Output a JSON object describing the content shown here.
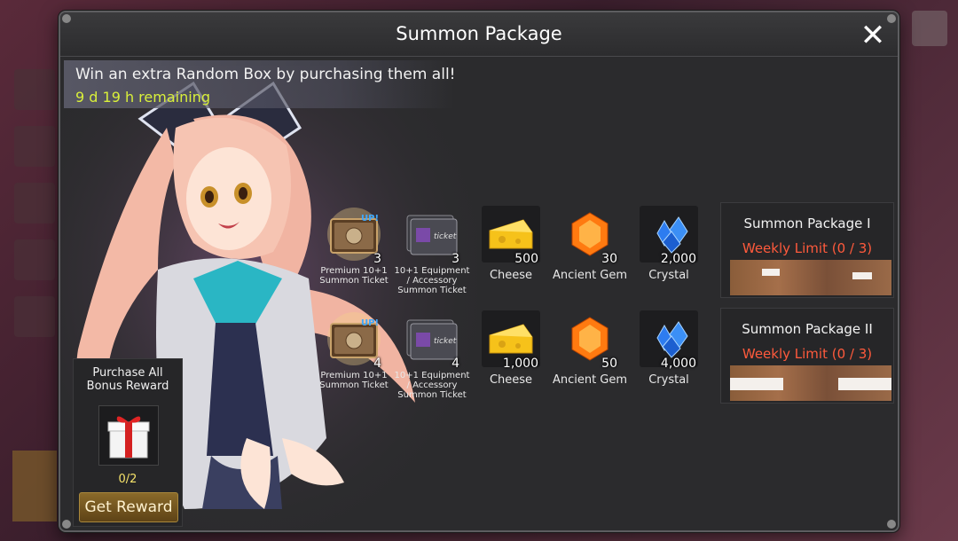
{
  "window": {
    "title": "Summon Package",
    "close_glyph": "✕"
  },
  "promo": {
    "text": "Win an extra Random Box by purchasing them all!",
    "timer": "9 d 19 h remaining"
  },
  "rows": [
    {
      "items": [
        {
          "icon": "premium-summon-ticket-icon",
          "qty": "3",
          "label": "Premium 10+1 Summon Ticket"
        },
        {
          "icon": "equipment-summon-ticket-icon",
          "qty": "3",
          "label": "10+1 Equipment / Accessory Summon Ticket"
        },
        {
          "icon": "cheese-icon",
          "qty": "500",
          "label": "Cheese"
        },
        {
          "icon": "ancient-gem-icon",
          "qty": "30",
          "label": "Ancient Gem"
        },
        {
          "icon": "crystal-icon",
          "qty": "2,000",
          "label": "Crystal"
        }
      ]
    },
    {
      "items": [
        {
          "icon": "premium-summon-ticket-icon",
          "qty": "4",
          "label": "Premium 10+1 Summon Ticket"
        },
        {
          "icon": "equipment-summon-ticket-icon",
          "qty": "4",
          "label": "10+1 Equipment / Accessory Summon Ticket"
        },
        {
          "icon": "cheese-icon",
          "qty": "1,000",
          "label": "Cheese"
        },
        {
          "icon": "ancient-gem-icon",
          "qty": "50",
          "label": "Ancient Gem"
        },
        {
          "icon": "crystal-icon",
          "qty": "4,000",
          "label": "Crystal"
        }
      ]
    }
  ],
  "packages": [
    {
      "name": "Summon Package I",
      "limit": "Weekly Limit (0 / 3)"
    },
    {
      "name": "Summon Package II",
      "limit": "Weekly Limit (0 / 3)"
    }
  ],
  "bonus": {
    "title_line1": "Purchase All",
    "title_line2": "Bonus Reward",
    "count": "0/2",
    "button_label": "Get Reward"
  },
  "colors": {
    "timer": "#d9f03a",
    "limit": "#ff5a3c",
    "panel": "#2b2b2d",
    "bonus_count": "#f6e36a"
  },
  "ticket_badge": "UP!",
  "ticket_word": "ticket"
}
